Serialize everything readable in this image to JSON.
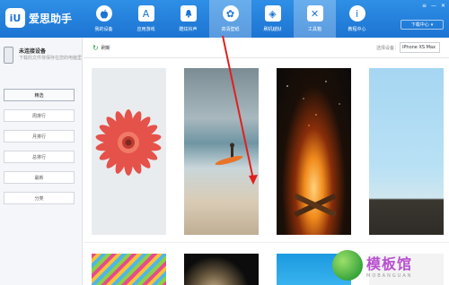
{
  "app": {
    "logo_badge": "iU",
    "name": "爱思助手"
  },
  "nav": {
    "items": [
      {
        "label": "我的设备",
        "icon": "apple-icon",
        "glyph": ""
      },
      {
        "label": "应用游戏",
        "icon": "app-store-icon",
        "glyph": "A"
      },
      {
        "label": "酷炫铃声",
        "icon": "bell-icon",
        "glyph": "🔔"
      },
      {
        "label": "高清壁纸",
        "icon": "flower-icon",
        "glyph": "✿"
      },
      {
        "label": "刷机越狱",
        "icon": "dropbox-icon",
        "glyph": "◈"
      },
      {
        "label": "工具箱",
        "icon": "tools-icon",
        "glyph": "✕"
      },
      {
        "label": "教程中心",
        "icon": "info-icon",
        "glyph": "i"
      }
    ],
    "download_label": "下载中心",
    "download_arrow": "▾"
  },
  "window_controls": {
    "menu": "≡",
    "minimize": "—",
    "close": "✕"
  },
  "sidebar": {
    "device_title": "未连接设备",
    "device_desc": "下载的文件将保存在您的电脑里",
    "items": [
      {
        "label": "精选",
        "active": true
      },
      {
        "label": "周排行"
      },
      {
        "label": "月排行"
      },
      {
        "label": "总排行"
      },
      {
        "label": "最新"
      },
      {
        "label": "分类"
      }
    ]
  },
  "toolbar": {
    "refresh_label": "刷新",
    "refresh_icon": "↻",
    "device_select_label": "选择设备：",
    "device_select_value": "iPhone XS Max"
  },
  "wallpapers": [
    {
      "name": "wallpaper-gerbera"
    },
    {
      "name": "wallpaper-surfer"
    },
    {
      "name": "wallpaper-bonfire"
    },
    {
      "name": "wallpaper-sky"
    },
    {
      "name": "wallpaper-stripes"
    },
    {
      "name": "wallpaper-planet"
    },
    {
      "name": "wallpaper-blue"
    },
    {
      "name": "wallpaper-light"
    }
  ],
  "watermark": {
    "main": "模板馆",
    "sub": "MOBANGUAN"
  },
  "colors": {
    "primary": "#1c74d2",
    "accent_green": "#2aa04a",
    "watermark_purple": "#b84fd0"
  }
}
